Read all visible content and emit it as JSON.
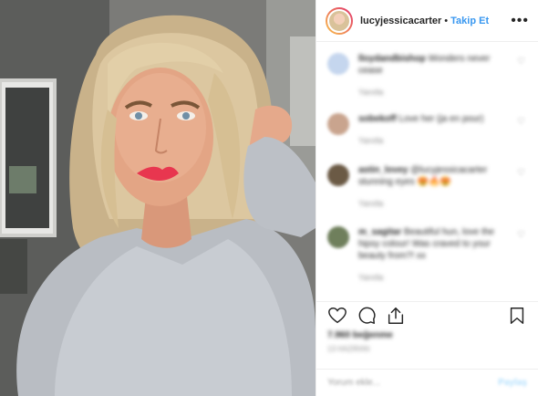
{
  "post": {
    "username": "lucyjessicacarter",
    "separator": "•",
    "follow_label": "Takip Et",
    "more_label": "•••"
  },
  "comments": [
    {
      "user": "lloydandbishop",
      "text": "Wonders never cease",
      "meta": "Yanıtla",
      "avatar_color": "#c5d6ee"
    },
    {
      "user": "sobekoff",
      "text": "Love her (ja en pour)",
      "meta": "Yanıtla",
      "avatar_color": "#c9a48e"
    },
    {
      "user": "astin_lovey",
      "text": "@lucyjessicacarter stunning eyes 😍🔥😍",
      "meta": "Yanıtla",
      "avatar_color": "#6b5a45"
    },
    {
      "user": "m_sagitar",
      "text": "Beautiful hun, love the hipsy colour! Was craved to your beauty from?! xx",
      "meta": "Yanıtla",
      "avatar_color": "#6f7f5c"
    }
  ],
  "actions": {
    "like_icon": "heart-icon",
    "comment_icon": "comment-icon",
    "share_icon": "share-icon",
    "save_icon": "bookmark-icon"
  },
  "likes_text": "7.960 beğenme",
  "date_text": "13 Haziran",
  "add_comment": {
    "placeholder": "Yorum ekle...",
    "post_label": "Paylaş"
  },
  "colors": {
    "accent": "#3897f0",
    "border": "#efefef",
    "text": "#262626",
    "muted": "#8e8e8e"
  }
}
